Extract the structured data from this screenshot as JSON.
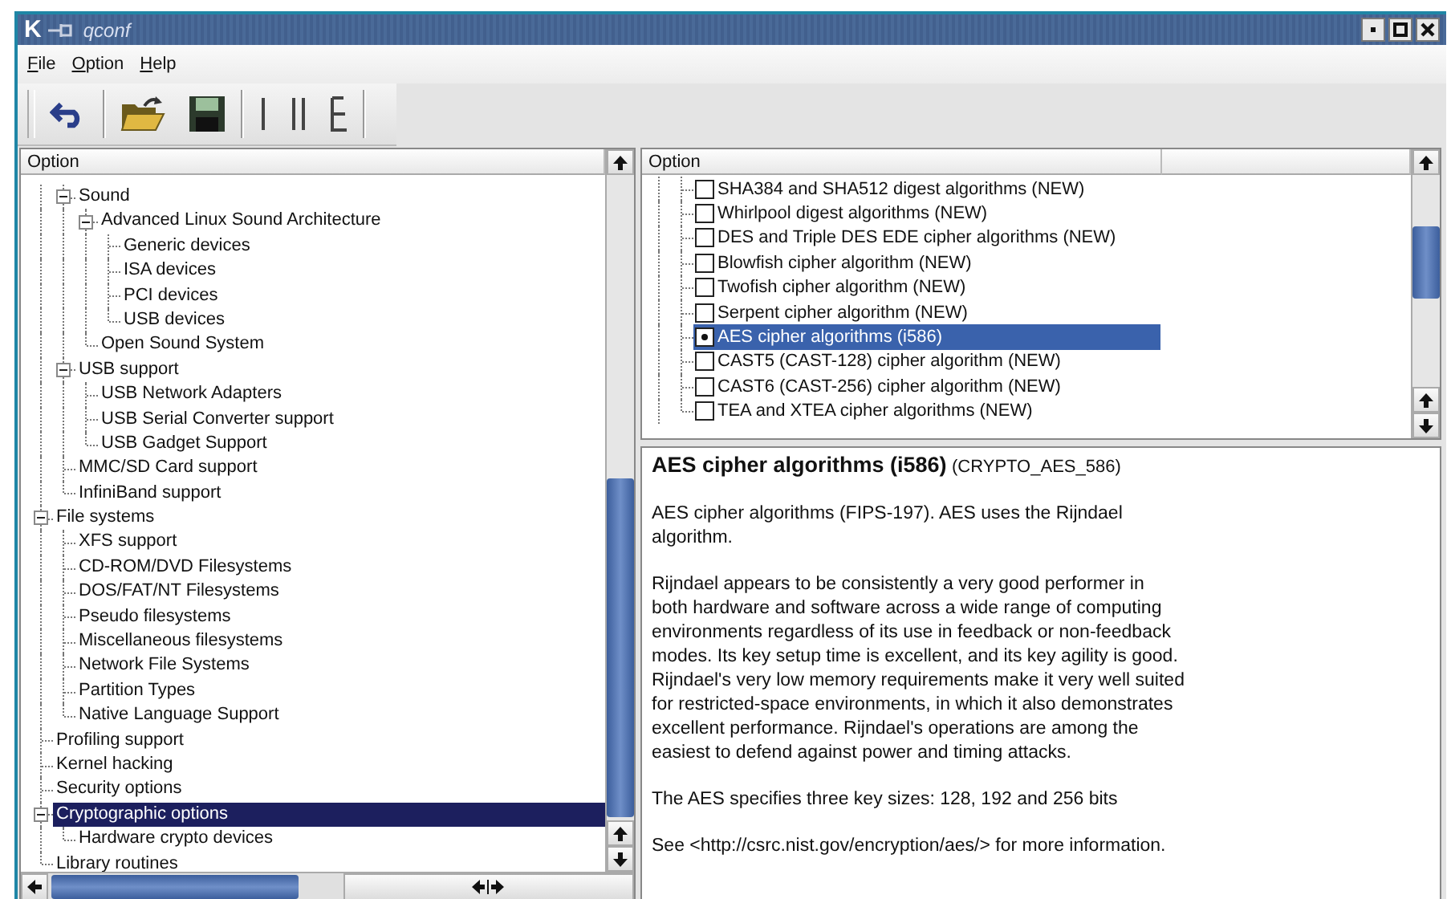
{
  "window": {
    "logo": "K",
    "title": "qconf"
  },
  "menu": [
    "File",
    "Option",
    "Help"
  ],
  "toolbar_groups": [
    [
      {
        "kind": "undo"
      }
    ],
    [
      {
        "kind": "open"
      },
      {
        "kind": "save"
      }
    ],
    [
      {
        "kind": "single_view"
      },
      {
        "kind": "split_view"
      },
      {
        "kind": "full_view"
      }
    ]
  ],
  "tree": {
    "column": "Option",
    "scrolled_parent_children": [
      {
        "label": "Sound",
        "selected": false,
        "expanded": true,
        "children": [
          {
            "label": "Advanced Linux Sound Architecture",
            "selected": false,
            "expanded": true,
            "children": [
              {
                "label": "Generic devices",
                "selected": false
              },
              {
                "label": "ISA devices",
                "selected": false
              },
              {
                "label": "PCI devices",
                "selected": false
              },
              {
                "label": "USB devices",
                "selected": false
              }
            ]
          },
          {
            "label": "Open Sound System",
            "selected": false
          }
        ]
      },
      {
        "label": "USB support",
        "selected": false,
        "expanded": true,
        "children": [
          {
            "label": "USB Network Adapters",
            "selected": false
          },
          {
            "label": "USB Serial Converter support",
            "selected": false
          },
          {
            "label": "USB Gadget Support",
            "selected": false
          }
        ]
      },
      {
        "label": "MMC/SD Card support",
        "selected": false
      },
      {
        "label": "InfiniBand support",
        "selected": false
      }
    ],
    "items": [
      {
        "label": "File systems",
        "selected": false,
        "expanded": true,
        "children": [
          {
            "label": "XFS support",
            "selected": false
          },
          {
            "label": "CD-ROM/DVD Filesystems",
            "selected": false
          },
          {
            "label": "DOS/FAT/NT Filesystems",
            "selected": false
          },
          {
            "label": "Pseudo filesystems",
            "selected": false
          },
          {
            "label": "Miscellaneous filesystems",
            "selected": false
          },
          {
            "label": "Network File Systems",
            "selected": false
          },
          {
            "label": "Partition Types",
            "selected": false
          },
          {
            "label": "Native Language Support",
            "selected": false
          }
        ]
      },
      {
        "label": "Profiling support",
        "selected": false
      },
      {
        "label": "Kernel hacking",
        "selected": false
      },
      {
        "label": "Security options",
        "selected": false
      },
      {
        "label": "Cryptographic options",
        "selected": true,
        "expanded": true,
        "children": [
          {
            "label": "Hardware crypto devices",
            "selected": false
          }
        ]
      },
      {
        "label": "Library routines",
        "selected": false
      }
    ]
  },
  "options": {
    "column": "Option",
    "items": [
      {
        "label": "SHA384 and SHA512 digest algorithms (NEW)",
        "checked": false,
        "selected": false
      },
      {
        "label": "Whirlpool digest algorithms (NEW)",
        "checked": false,
        "selected": false
      },
      {
        "label": "DES and Triple DES EDE cipher algorithms (NEW)",
        "checked": false,
        "selected": false
      },
      {
        "label": "Blowfish cipher algorithm (NEW)",
        "checked": false,
        "selected": false
      },
      {
        "label": "Twofish cipher algorithm (NEW)",
        "checked": false,
        "selected": false
      },
      {
        "label": "Serpent cipher algorithm (NEW)",
        "checked": false,
        "selected": false
      },
      {
        "label": "AES cipher algorithms (i586)",
        "checked": true,
        "selected": true
      },
      {
        "label": "CAST5 (CAST-128) cipher algorithm (NEW)",
        "checked": false,
        "selected": false
      },
      {
        "label": "CAST6 (CAST-256) cipher algorithm (NEW)",
        "checked": false,
        "selected": false
      },
      {
        "label": "TEA and XTEA cipher algorithms (NEW)",
        "checked": false,
        "selected": false
      }
    ]
  },
  "help": {
    "title": "AES cipher algorithms (i586)",
    "symbol": "(CRYPTO_AES_586)",
    "paragraphs": [
      "AES cipher algorithms (FIPS-197). AES uses the Rijndael algorithm.",
      "Rijndael appears to be consistently a very good performer in both hardware and software across a wide range of computing environments regardless of its use in feedback or non-feedback modes. Its key setup time is excellent, and its key agility is good. Rijndael's very low memory requirements make it very well suited for restricted-space environments, in which it also demonstrates excellent performance. Rijndael's operations are among the easiest to defend against power and timing attacks.",
      "The AES specifies three key sizes: 128, 192 and 256 bits",
      "See <http://csrc.nist.gov/encryption/aes/> for more information."
    ]
  }
}
